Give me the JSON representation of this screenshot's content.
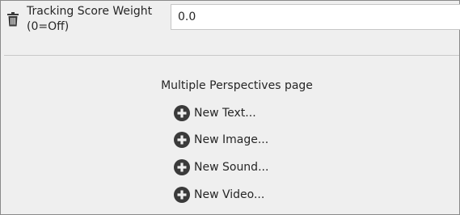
{
  "tracking_score": {
    "label_line1": "Tracking Score Weight",
    "label_line2": "(0=Off)",
    "value": "0.0"
  },
  "page": {
    "title": "Multiple Perspectives page",
    "actions": [
      {
        "label": "New Text...",
        "icon": "plus-circle-icon"
      },
      {
        "label": "New Image...",
        "icon": "plus-circle-icon"
      },
      {
        "label": "New Sound...",
        "icon": "plus-circle-icon"
      },
      {
        "label": "New Video...",
        "icon": "plus-circle-icon"
      }
    ]
  },
  "colors": {
    "background": "#efefef",
    "icon": "#3a3a3a",
    "text": "#262626"
  }
}
